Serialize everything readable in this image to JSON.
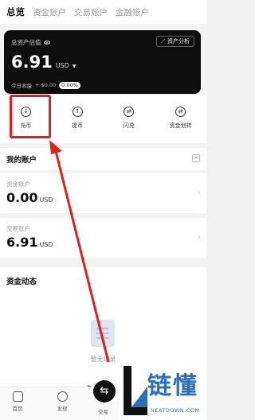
{
  "tabs": [
    "总览",
    "资金账户",
    "交易账户",
    "金融账户"
  ],
  "card": {
    "label": "总资产估值",
    "analysis_button": "资产分析",
    "amount": "6.91",
    "currency": "USD",
    "today_label": "今日收益",
    "today_value": "+ $0.00",
    "today_pct": "0.00%"
  },
  "actions": [
    {
      "label": "充币",
      "icon": "deposit-icon"
    },
    {
      "label": "提币",
      "icon": "withdraw-icon"
    },
    {
      "label": "闪兑",
      "icon": "swap-icon"
    },
    {
      "label": "资金划转",
      "icon": "transfer-icon"
    }
  ],
  "accounts": {
    "title": "我的账户",
    "items": [
      {
        "label": "资金账户",
        "value": "0.00",
        "unit": "USD"
      },
      {
        "label": "交易账户",
        "value": "6.91",
        "unit": "USD"
      }
    ]
  },
  "funds": {
    "title": "资金动态",
    "empty_text": "暂无记录"
  },
  "bottom_nav": [
    {
      "label": "首页",
      "icon": "home-icon"
    },
    {
      "label": "发现",
      "icon": "discover-icon"
    },
    {
      "label": "交易",
      "icon": "trade-icon"
    }
  ],
  "watermark": {
    "cn": "链懂",
    "en": "NEATDOWN.COM"
  },
  "colors": {
    "highlight": "#e02020",
    "card_bg": "#0e0e0e",
    "watermark": "#2a6fb7"
  }
}
